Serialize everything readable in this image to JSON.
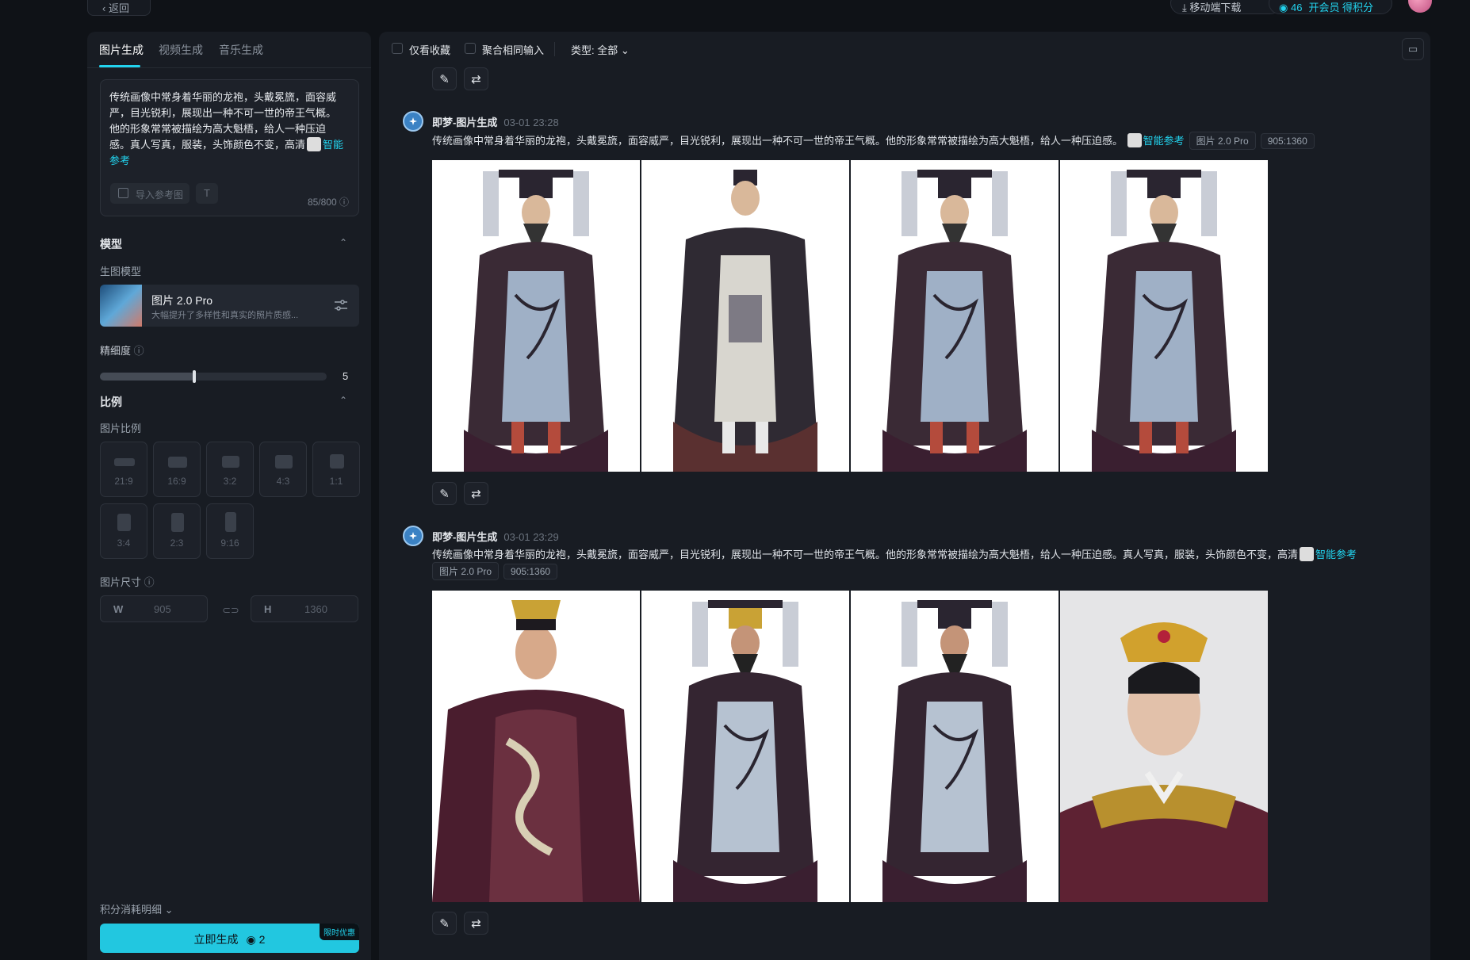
{
  "topbar": {
    "back_label": "返回",
    "download_label": "移动端下载",
    "points_value": "46",
    "vip_label": "开会员 得积分"
  },
  "sidebar": {
    "tabs": [
      {
        "label": "图片生成",
        "active": true
      },
      {
        "label": "视频生成",
        "active": false
      },
      {
        "label": "音乐生成",
        "active": false
      }
    ],
    "prompt": {
      "text": "传统画像中常身着华丽的龙袍，头戴冕旒，面容威严，目光锐利，展现出一种不可一世的帝王气概。他的形象常常被描绘为高大魁梧，给人一种压迫感。真人写真，服装，头饰颜色不变，高清",
      "smart_ref_label": "智能参考",
      "import_ref_label": "导入参考图",
      "text_btn": "T",
      "char_count": "85/800"
    },
    "model_section": {
      "title": "模型",
      "sub_label": "生图模型",
      "model_name": "图片 2.0 Pro",
      "model_desc": "大幅提升了多样性和真实的照片质感..."
    },
    "detail": {
      "label": "精细度",
      "value": "5",
      "level": 0.5
    },
    "ratio_section": {
      "title": "比例",
      "sub_label": "图片比例",
      "ratios": [
        "21:9",
        "16:9",
        "3:2",
        "4:3",
        "1:1",
        "3:4",
        "2:3",
        "9:16"
      ]
    },
    "size": {
      "label": "图片尺寸",
      "w_label": "W",
      "w_value": "905",
      "h_label": "H",
      "h_value": "1360"
    },
    "cost_label": "积分消耗明细",
    "generate": {
      "label": "立即生成",
      "cost": "2",
      "promo": "限时优惠"
    }
  },
  "main": {
    "filters": {
      "favorites_label": "仅看收藏",
      "merge_label": "聚合相同输入",
      "type_label": "类型: 全部"
    },
    "generations": [
      {
        "title": "即梦-图片生成",
        "time": "03-01  23:28",
        "prompt": "传统画像中常身着华丽的龙袍，头戴冕旒，面容威严，目光锐利，展现出一种不可一世的帝王气概。他的形象常常被描绘为高大魁梧，给人一种压迫感。",
        "smart_ref_label": "智能参考",
        "model_tag": "图片 2.0 Pro",
        "size_tag": "905:1360"
      },
      {
        "title": "即梦-图片生成",
        "time": "03-01  23:29",
        "prompt": "传统画像中常身着华丽的龙袍，头戴冕旒，面容威严，目光锐利，展现出一种不可一世的帝王气概。他的形象常常被描绘为高大魁梧，给人一种压迫感。真人写真，服装，头饰颜色不变，高清",
        "smart_ref_label": "智能参考",
        "model_tag": "图片 2.0 Pro",
        "size_tag": "905:1360"
      }
    ]
  },
  "colors": {
    "accent": "#22d3ee",
    "bg": "#0f1217",
    "panel": "#181c23"
  }
}
